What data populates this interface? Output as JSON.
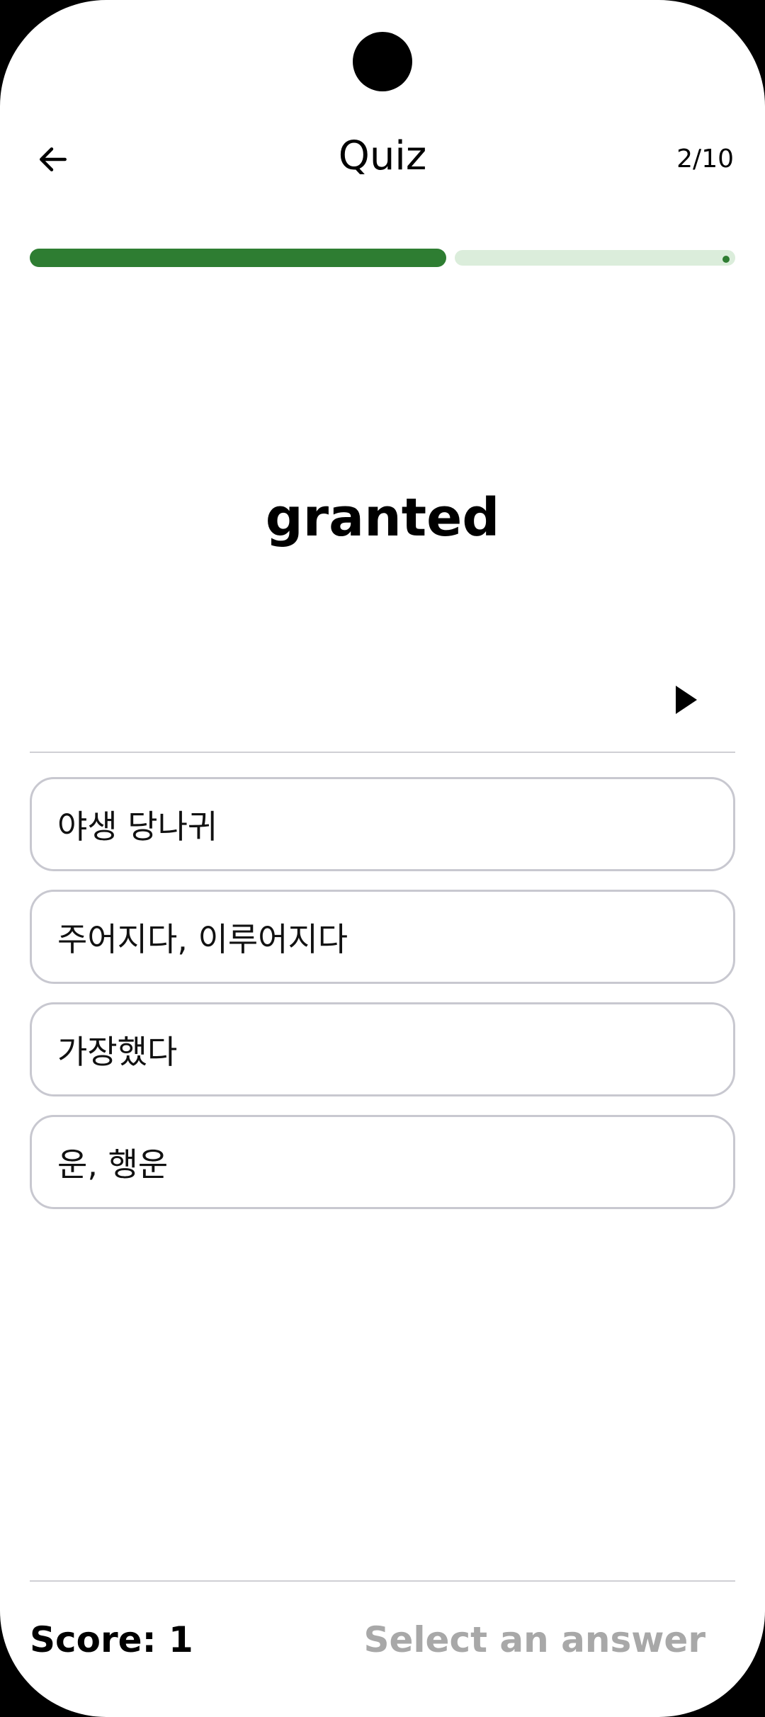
{
  "header": {
    "title": "Quiz",
    "counter": "2/10",
    "back_icon": "arrow-left-icon"
  },
  "progress": {
    "current": 2,
    "total": 10,
    "fraction": 0.59,
    "fill_color": "#2e7d32",
    "track_color": "#dbeddb"
  },
  "question": {
    "word": "granted",
    "play_icon": "play-icon"
  },
  "options": [
    {
      "label": "야생 당나귀"
    },
    {
      "label": "주어지다, 이루어지다"
    },
    {
      "label": "가장했다"
    },
    {
      "label": "운, 행운"
    }
  ],
  "footer": {
    "score": "Score: 1",
    "hint": "Select an answer"
  }
}
